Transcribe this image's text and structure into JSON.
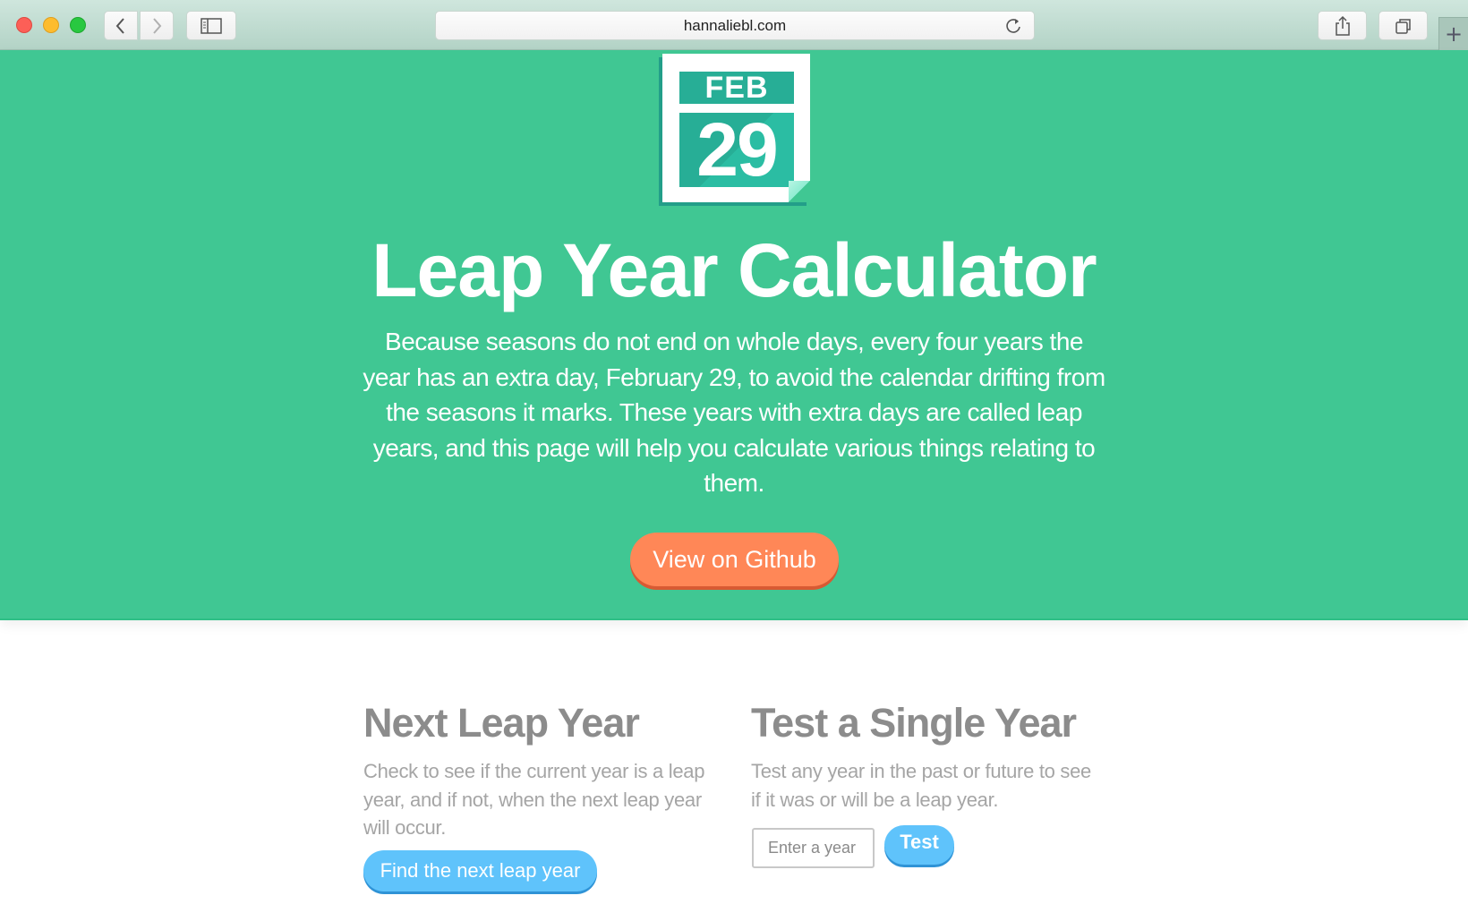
{
  "browser": {
    "url": "hannaliebl.com",
    "new_tab_symbol": "+"
  },
  "hero": {
    "calendar_month": "FEB",
    "calendar_day": "29",
    "title": "Leap Year Calculator",
    "description": "Because seasons do not end on whole days, every four years the year has an extra day, February 29, to avoid the calendar drifting from the seasons it marks. These years with extra days are called leap years, and this page will help you calculate various things relating to them.",
    "github_button": "View on Github",
    "colors": {
      "background": "#40c793",
      "button": "#ff8757"
    }
  },
  "next_leap": {
    "heading": "Next Leap Year",
    "description": "Check to see if the current year is a leap year, and if not, when the next leap year will occur.",
    "button": "Find the next leap year"
  },
  "test_year": {
    "heading": "Test a Single Year",
    "description": "Test any year in the past or future to see if it was or will be a leap year.",
    "input_placeholder": "Enter a year",
    "input_value": "",
    "button": "Test"
  }
}
